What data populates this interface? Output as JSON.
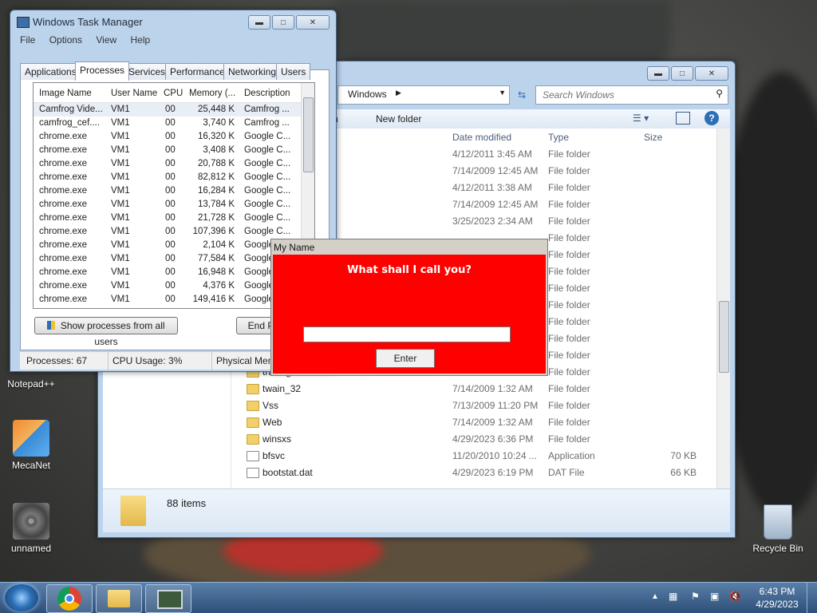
{
  "desktop": {
    "icons": [
      {
        "label": "Notepad++"
      },
      {
        "label": "MecaNet"
      },
      {
        "label": "unnamed"
      },
      {
        "label": "Recycle Bin"
      }
    ]
  },
  "explorer": {
    "address_segment": "Windows",
    "search_placeholder": "Search Windows",
    "toolbar": {
      "partial_label": "n",
      "new_folder": "New folder"
    },
    "columns": {
      "date": "Date modified",
      "type": "Type",
      "size": "Size"
    },
    "rows": [
      {
        "name": "",
        "date": "4/12/2011 3:45 AM",
        "type": "File folder",
        "size": ""
      },
      {
        "name": "",
        "date": "7/14/2009 12:45 AM",
        "type": "File folder",
        "size": ""
      },
      {
        "name": "",
        "date": "4/12/2011 3:38 AM",
        "type": "File folder",
        "size": ""
      },
      {
        "name": "",
        "date": "7/14/2009 12:45 AM",
        "type": "File folder",
        "size": ""
      },
      {
        "name": "on",
        "date": "3/25/2023 2:34 AM",
        "type": "File folder",
        "size": ""
      },
      {
        "name": "",
        "date": "",
        "type": "File folder",
        "size": ""
      },
      {
        "name": "",
        "date": "",
        "type": "File folder",
        "size": ""
      },
      {
        "name": "",
        "date": "",
        "type": "File folder",
        "size": ""
      },
      {
        "name": "",
        "date": "",
        "type": "File folder",
        "size": ""
      },
      {
        "name": "",
        "date": "",
        "type": "File folder",
        "size": ""
      },
      {
        "name": "",
        "date": "",
        "type": "File folder",
        "size": ""
      },
      {
        "name": "",
        "date": "",
        "type": "File folder",
        "size": ""
      },
      {
        "name": "",
        "date": "",
        "type": "File folder",
        "size": ""
      },
      {
        "name": "tracing",
        "date": "3/23/2023 6:14 AM",
        "type": "File folder",
        "size": ""
      },
      {
        "name": "twain_32",
        "date": "7/14/2009 1:32 AM",
        "type": "File folder",
        "size": ""
      },
      {
        "name": "Vss",
        "date": "7/13/2009 11:20 PM",
        "type": "File folder",
        "size": ""
      },
      {
        "name": "Web",
        "date": "7/14/2009 1:32 AM",
        "type": "File folder",
        "size": ""
      },
      {
        "name": "winsxs",
        "date": "4/29/2023 6:36 PM",
        "type": "File folder",
        "size": ""
      },
      {
        "name": "bfsvc",
        "date": "11/20/2010 10:24 ...",
        "type": "Application",
        "size": "70 KB"
      },
      {
        "name": "bootstat.dat",
        "date": "4/29/2023 6:19 PM",
        "type": "DAT File",
        "size": "66 KB"
      }
    ],
    "item_count": "88 items"
  },
  "task_manager": {
    "title": "Windows Task Manager",
    "menu": [
      "File",
      "Options",
      "View",
      "Help"
    ],
    "tabs": [
      "Applications",
      "Processes",
      "Services",
      "Performance",
      "Networking",
      "Users"
    ],
    "columns": [
      "Image Name",
      "User Name",
      "CPU",
      "Memory (...",
      "Description"
    ],
    "rows": [
      {
        "image": "Camfrog Vide...",
        "user": "VM1",
        "cpu": "00",
        "mem": "25,448 K",
        "desc": "Camfrog ..."
      },
      {
        "image": "camfrog_cef....",
        "user": "VM1",
        "cpu": "00",
        "mem": "3,740 K",
        "desc": "Camfrog ..."
      },
      {
        "image": "chrome.exe",
        "user": "VM1",
        "cpu": "00",
        "mem": "16,320 K",
        "desc": "Google C..."
      },
      {
        "image": "chrome.exe",
        "user": "VM1",
        "cpu": "00",
        "mem": "3,408 K",
        "desc": "Google C..."
      },
      {
        "image": "chrome.exe",
        "user": "VM1",
        "cpu": "00",
        "mem": "20,788 K",
        "desc": "Google C..."
      },
      {
        "image": "chrome.exe",
        "user": "VM1",
        "cpu": "00",
        "mem": "82,812 K",
        "desc": "Google C..."
      },
      {
        "image": "chrome.exe",
        "user": "VM1",
        "cpu": "00",
        "mem": "16,284 K",
        "desc": "Google C..."
      },
      {
        "image": "chrome.exe",
        "user": "VM1",
        "cpu": "00",
        "mem": "13,784 K",
        "desc": "Google C..."
      },
      {
        "image": "chrome.exe",
        "user": "VM1",
        "cpu": "00",
        "mem": "21,728 K",
        "desc": "Google C..."
      },
      {
        "image": "chrome.exe",
        "user": "VM1",
        "cpu": "00",
        "mem": "107,396 K",
        "desc": "Google C..."
      },
      {
        "image": "chrome.exe",
        "user": "VM1",
        "cpu": "00",
        "mem": "2,104 K",
        "desc": "Google"
      },
      {
        "image": "chrome.exe",
        "user": "VM1",
        "cpu": "00",
        "mem": "77,584 K",
        "desc": "Google"
      },
      {
        "image": "chrome.exe",
        "user": "VM1",
        "cpu": "00",
        "mem": "16,948 K",
        "desc": "Google"
      },
      {
        "image": "chrome.exe",
        "user": "VM1",
        "cpu": "00",
        "mem": "4,376 K",
        "desc": "Google"
      },
      {
        "image": "chrome.exe",
        "user": "VM1",
        "cpu": "00",
        "mem": "149,416 K",
        "desc": "Google"
      }
    ],
    "show_all_button": "Show processes from all users",
    "end_button": "End P",
    "status": {
      "processes": "Processes: 67",
      "cpu": "CPU Usage: 3%",
      "memory": "Physical Memo"
    }
  },
  "dialog": {
    "title": "My Name",
    "prompt": "What shall I call you?",
    "input_value": "",
    "enter_button": "Enter",
    "background_color": "#ff0000"
  },
  "taskbar": {
    "time": "6:43 PM",
    "date": "4/29/2023"
  }
}
